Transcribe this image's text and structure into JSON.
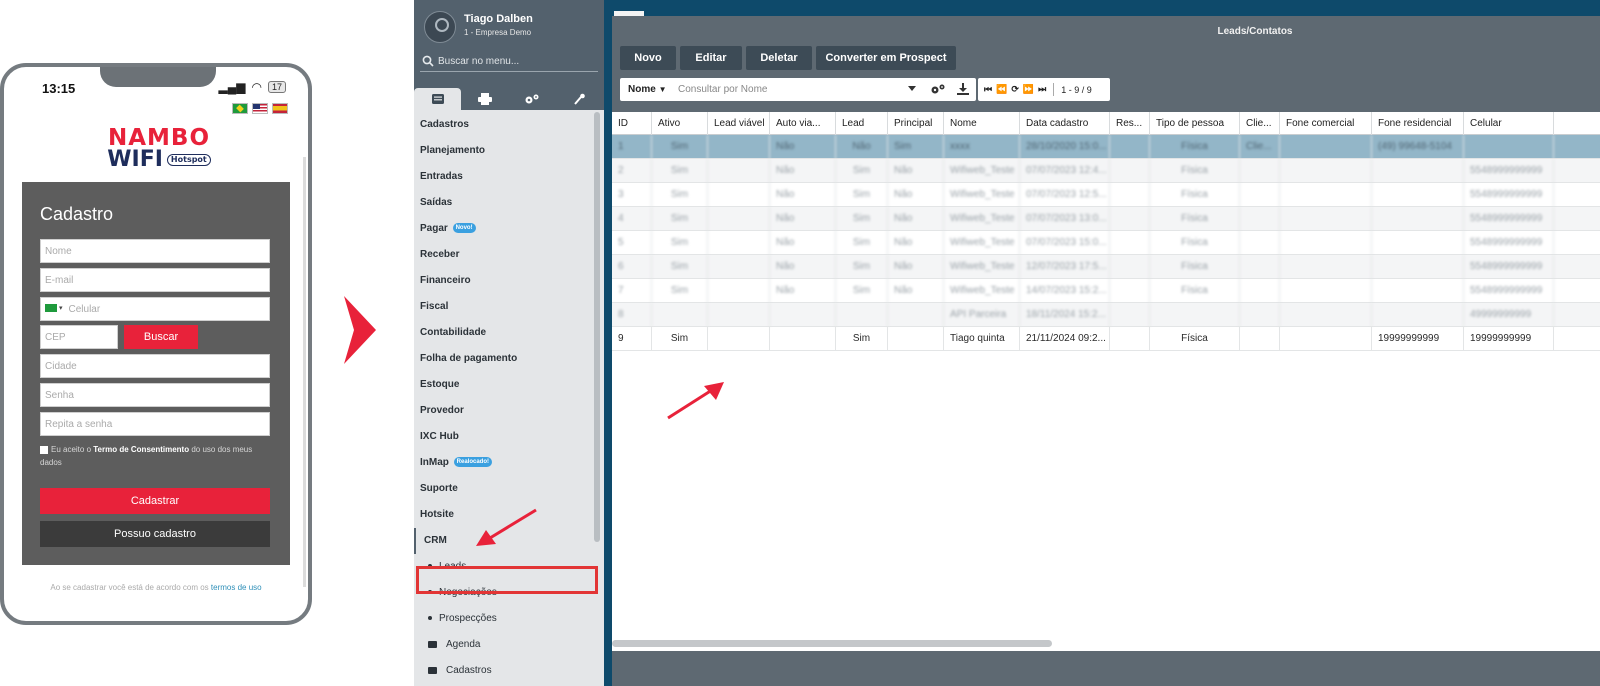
{
  "phone": {
    "time": "13:15",
    "battery": "17",
    "logo_line1": "NAMBO",
    "logo_line2": "WIFI",
    "logo_badge": "Hotspot",
    "form_title": "Cadastro",
    "placeholders": {
      "nome": "Nome",
      "email": "E-mail",
      "celular": "Celular",
      "cep": "CEP",
      "cidade": "Cidade",
      "senha": "Senha",
      "repita": "Repita a senha"
    },
    "buscar_label": "Buscar",
    "consent_pre": "Eu aceito o ",
    "consent_bold": "Termo de Consentimento",
    "consent_post": " do uso dos meus dados",
    "cadastrar_label": "Cadastrar",
    "possuo_label": "Possuo cadastro",
    "footer_pre": "Ao se cadastrar você está de acordo com os ",
    "footer_link": "termos de uso"
  },
  "sidebar": {
    "user_name": "Tiago Dalben",
    "company": "1 - Empresa Demo",
    "search_placeholder": "Buscar no menu...",
    "items": [
      {
        "label": "Cadastros"
      },
      {
        "label": "Planejamento"
      },
      {
        "label": "Entradas"
      },
      {
        "label": "Saídas"
      },
      {
        "label": "Pagar",
        "badge": "Novo!"
      },
      {
        "label": "Receber"
      },
      {
        "label": "Financeiro"
      },
      {
        "label": "Fiscal"
      },
      {
        "label": "Contabilidade"
      },
      {
        "label": "Folha de pagamento"
      },
      {
        "label": "Estoque"
      },
      {
        "label": "Provedor"
      },
      {
        "label": "IXC Hub"
      },
      {
        "label": "InMap",
        "badge": "Realocado!"
      },
      {
        "label": "Suporte"
      },
      {
        "label": "Hotsite"
      }
    ],
    "crm_label": "CRM",
    "crm_children": [
      "Leads",
      "Negociações",
      "Prospecções"
    ],
    "folders": [
      "Agenda",
      "Cadastros"
    ]
  },
  "main": {
    "title": "Leads/Contatos",
    "buttons": [
      "Novo",
      "Editar",
      "Deletar",
      "Converter em Prospect"
    ],
    "field_select": "Nome",
    "search_placeholder": "Consultar por Nome",
    "pager_range": "1 - 9 / 9",
    "columns": [
      "ID",
      "Ativo",
      "Lead viável",
      "Auto via...",
      "Lead",
      "Principal",
      "Nome",
      "Data cadastro",
      "Res...",
      "Tipo de pessoa",
      "Clie...",
      "Fone comercial",
      "Fone residencial",
      "Celular"
    ],
    "rows": [
      [
        "1",
        "Sim",
        "",
        "Não",
        "Não",
        "Sim",
        "xxxx",
        "28/10/2020 15:0...",
        "",
        "Física",
        "Clie...",
        "",
        "(49) 99648-5104",
        ""
      ],
      [
        "2",
        "Sim",
        "",
        "Não",
        "Sim",
        "Não",
        "Wifiweb_Teste",
        "07/07/2023 12:4...",
        "",
        "Física",
        "",
        "",
        "",
        "5548999999999"
      ],
      [
        "3",
        "Sim",
        "",
        "Não",
        "Sim",
        "Não",
        "Wifiweb_Teste",
        "07/07/2023 12:5...",
        "",
        "Física",
        "",
        "",
        "",
        "5548999999999"
      ],
      [
        "4",
        "Sim",
        "",
        "Não",
        "Sim",
        "Não",
        "Wifiweb_Teste",
        "07/07/2023 13:0...",
        "",
        "Física",
        "",
        "",
        "",
        "5548999999999"
      ],
      [
        "5",
        "Sim",
        "",
        "Não",
        "Sim",
        "Não",
        "Wifiweb_Teste",
        "07/07/2023 15:0...",
        "",
        "Física",
        "",
        "",
        "",
        "5548999999999"
      ],
      [
        "6",
        "Sim",
        "",
        "Não",
        "Sim",
        "Não",
        "Wifiweb_Teste",
        "12/07/2023 17:5...",
        "",
        "Física",
        "",
        "",
        "",
        "5548999999999"
      ],
      [
        "7",
        "Sim",
        "",
        "Não",
        "Sim",
        "Não",
        "Wifiweb_Teste",
        "14/07/2023 15:2...",
        "",
        "Física",
        "",
        "",
        "",
        "5548999999999"
      ],
      [
        "8",
        "",
        "",
        "",
        "",
        "",
        "API Parceira",
        "18/11/2024 15:2...",
        "",
        "",
        "",
        "",
        "",
        "49999999999"
      ],
      [
        "9",
        "Sim",
        "",
        "",
        "Sim",
        "",
        "Tiago quinta",
        "21/11/2024 09:2...",
        "",
        "Física",
        "",
        "",
        "19999999999",
        "19999999999"
      ]
    ]
  },
  "colors": {
    "accent_red": "#e8223a",
    "sidebar_header": "#53616d",
    "window_bg": "#0e4a6b",
    "selected_row": "#93b6c8"
  }
}
